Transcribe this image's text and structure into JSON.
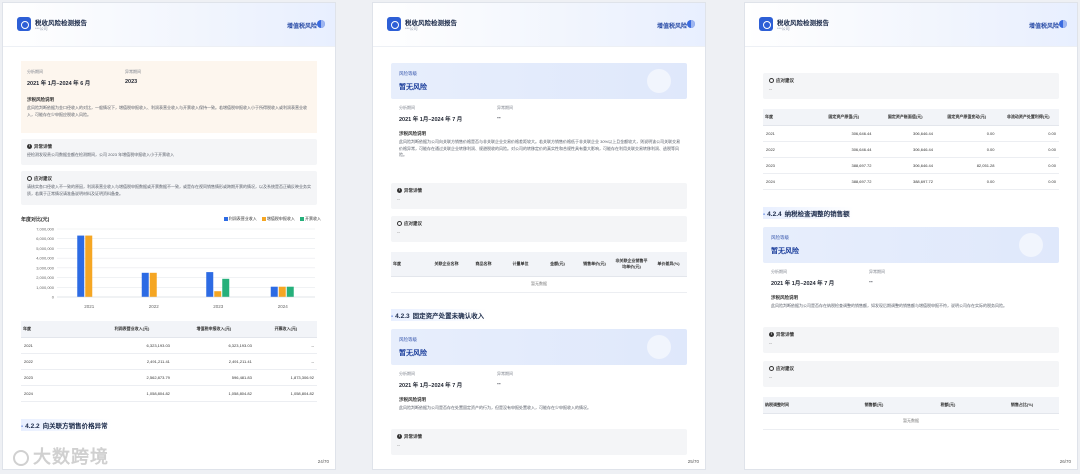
{
  "header": {
    "title": "税收风险检测报告",
    "subtitle": "***公司",
    "right_label": "增值税风险"
  },
  "page1": {
    "period_label": "分析期间",
    "period_value": "2021 年 1月–2024 年 6 月",
    "abnormal_label": "异常期间",
    "abnormal_value": "2023",
    "desc_title": "涉税风险说明",
    "desc_text": "此风险判断依据为金口径收入的对比，一般情况下，增值税申报收入、利润表营业收入与开票收入保持一致。若增值税申报收入小于所得税收入或利润表营业收入，可能存在少申报应税收入风险。",
    "detail_title": "异常详情",
    "detail_text": "经检测发现贵公司数据金额在检测期间，公司 2023 年增值税申报收入小于开票收入",
    "advice_title": "应对建议",
    "advice_text": "请核实各口径收入不一致的原因，利润表营业收入与增值税申报数据或开票数据不一致，或是存在视同销售情形或跨期开票的情况，以及系统是否正确反映业务实质，若属于正常情况请准备说明材料及证明资料备查。",
    "chart_title": "年度对比(元)",
    "legend": [
      "利润表营业收入",
      "增值税申报收入",
      "开票收入"
    ],
    "table_headers": [
      "年度",
      "利润表营业收入(元)",
      "增值税申报收入(元)",
      "开票收入(元)"
    ],
    "table_rows": [
      [
        "2021",
        "6,323,193.03",
        "6,323,193.03",
        "--"
      ],
      [
        "2022",
        "2,491,211.41",
        "2,491,211.41",
        "--"
      ],
      [
        "2023",
        "2,562,873.79",
        "596,481.83",
        "1,873,306.92"
      ],
      [
        "2024",
        "1,058,804.82",
        "1,058,804.82",
        "1,058,804.82"
      ]
    ],
    "next_section_num": "4.2.2",
    "next_section": "向关联方销售价格异常",
    "page_num": "24/70"
  },
  "chart_data": {
    "type": "bar",
    "title": "年度对比(元)",
    "categories": [
      "2021",
      "2022",
      "2023",
      "2024"
    ],
    "series": [
      {
        "name": "利润表营业收入",
        "values": [
          6323193.03,
          2491211.41,
          2562873.79,
          1058804.82
        ],
        "color": "#2d6be4"
      },
      {
        "name": "增值税申报收入",
        "values": [
          6323193.03,
          2491211.41,
          596481.83,
          1058804.82
        ],
        "color": "#f5a623"
      },
      {
        "name": "开票收入",
        "values": [
          0,
          0,
          1873306.92,
          1058804.82
        ],
        "color": "#26b07b"
      }
    ],
    "ylim": [
      0,
      7000000
    ],
    "yticks": [
      "0",
      "1,000,000",
      "2,000,000",
      "3,000,000",
      "4,000,000",
      "5,000,000",
      "6,000,000",
      "7,000,000"
    ],
    "legend_position": "top-right",
    "grid": true
  },
  "page2": {
    "risk_label": "风险等级",
    "risk_value": "暂无风险",
    "period_label": "分析期间",
    "period_value": "2021 年 1月–2024 年 7 月",
    "abnormal_label": "异常期间",
    "abnormal_value": "--",
    "desc_title": "涉税风险说明",
    "desc_text": "此风险判断依据为公司向关联方销售价格是否与非关联企业交易价格差距较大。若关联方销售价格低于非关联企业 30%以上且金额较大，则说明该公司关联交易价格异常，可能存在通过关联企业转移利润、规避税收的风险。对公司的转移定价的真实性和合规性具有重大影响，可能存在利用关联交易转移利润、逃税等风险。",
    "detail_title": "异常详情",
    "detail_value": "--",
    "advice_title": "应对建议",
    "advice_value": "--",
    "table_headers": [
      "年度",
      "关联企业名称",
      "商品名称",
      "计量单位",
      "金额(元)",
      "销售单价(元)",
      "非关联企业销售平均单价(元)",
      "单价差异(%)"
    ],
    "no_data": "暂无数据",
    "section_num": "4.2.3",
    "section": "固定资产处置未确认收入",
    "risk2_label": "风险等级",
    "risk2_value": "暂无风险",
    "period2_label": "分析期间",
    "period2_value": "2021 年 1月–2024 年 7 月",
    "abnormal2_label": "异常期间",
    "abnormal2_value": "--",
    "desc2_title": "涉税风险说明",
    "desc2_text": "此风险判断依据为公司是否存在处置固定资产的行为，但是没有申报处置收入，可能存在少申报收入的情况。",
    "detail2_title": "异常详情",
    "detail2_value": "--",
    "page_num": "25/70"
  },
  "page3": {
    "advice_title": "应对建议",
    "advice_value": "--",
    "table_headers": [
      "年度",
      "固定资产原值(元)",
      "固定资产账面值(元)",
      "固定资产原值变动(元)",
      "非流动资产处置利得(元)"
    ],
    "table_rows": [
      [
        "2021",
        "306,646.44",
        "306,646.44",
        "0.00",
        "0.00"
      ],
      [
        "2022",
        "306,646.44",
        "306,646.44",
        "0.00",
        "0.00"
      ],
      [
        "2023",
        "388,697.72",
        "306,646.44",
        "82,051.28",
        "0.00"
      ],
      [
        "2024",
        "388,697.72",
        "388,697.72",
        "0.00",
        "0.00"
      ]
    ],
    "section_num": "4.2.4",
    "section": "纳税检查调整的销售额",
    "risk_label": "风险等级",
    "risk_value": "暂无风险",
    "period_label": "分析期间",
    "period_value": "2021 年 1月–2024 年 7 月",
    "abnormal_label": "异常期间",
    "abnormal_value": "--",
    "desc_title": "涉税风险说明",
    "desc_text": "此风险判断依据为公司是否存在纳税检查调整的销售额，如发现后期调整的销售额与增值税申报不符，说明公司存在实际的税务风险。",
    "detail_title": "异常详情",
    "detail_value": "--",
    "advice2_title": "应对建议",
    "advice2_value": "--",
    "table2_headers": [
      "纳税调整时间",
      "销售额(元)",
      "税额(元)",
      "销售占比(%)"
    ],
    "no_data": "暂无数据",
    "page_num": "26/70"
  },
  "watermark": "大数跨境"
}
